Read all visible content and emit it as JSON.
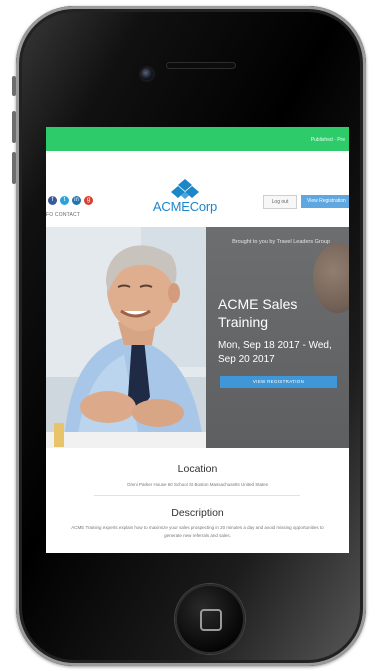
{
  "top_bar": {
    "promo_text": "Published · Pre",
    "color": "#2ecb6a"
  },
  "header": {
    "social_icons": [
      {
        "icon": "facebook-icon",
        "glyph": "f",
        "color": "#3b5b98"
      },
      {
        "icon": "twitter-icon",
        "glyph": "t",
        "color": "#2aa3d8"
      },
      {
        "icon": "linkedin-icon",
        "glyph": "in",
        "color": "#1e75b2"
      },
      {
        "icon": "google-plus-icon",
        "glyph": "g",
        "color": "#d7402f"
      }
    ],
    "logo_acme": "ACME",
    "logo_corp": "Corp",
    "login_label": "Log out",
    "register_label": "View Registration",
    "nav_text": "FO   CONTACT"
  },
  "hero": {
    "brought_by": "Brought to you by Travel Leaders Group",
    "event_title": "ACME Sales Training",
    "event_dates": "Mon, Sep 18 2017 - Wed, Sep 20 2017",
    "button_label": "VIEW REGISTRATION"
  },
  "location": {
    "heading": "Location",
    "address": "Omni Parker House 60 School St Boston Massachusetts United States"
  },
  "description": {
    "heading": "Description",
    "text": "ACME Training experts explain how to maximize your sales prospecting in 20 minutes a day and avoid missing opportunities to generate new referrals and sales."
  },
  "colors": {
    "accent_blue": "#3f97d8",
    "logo_blue": "#1b86c8"
  }
}
